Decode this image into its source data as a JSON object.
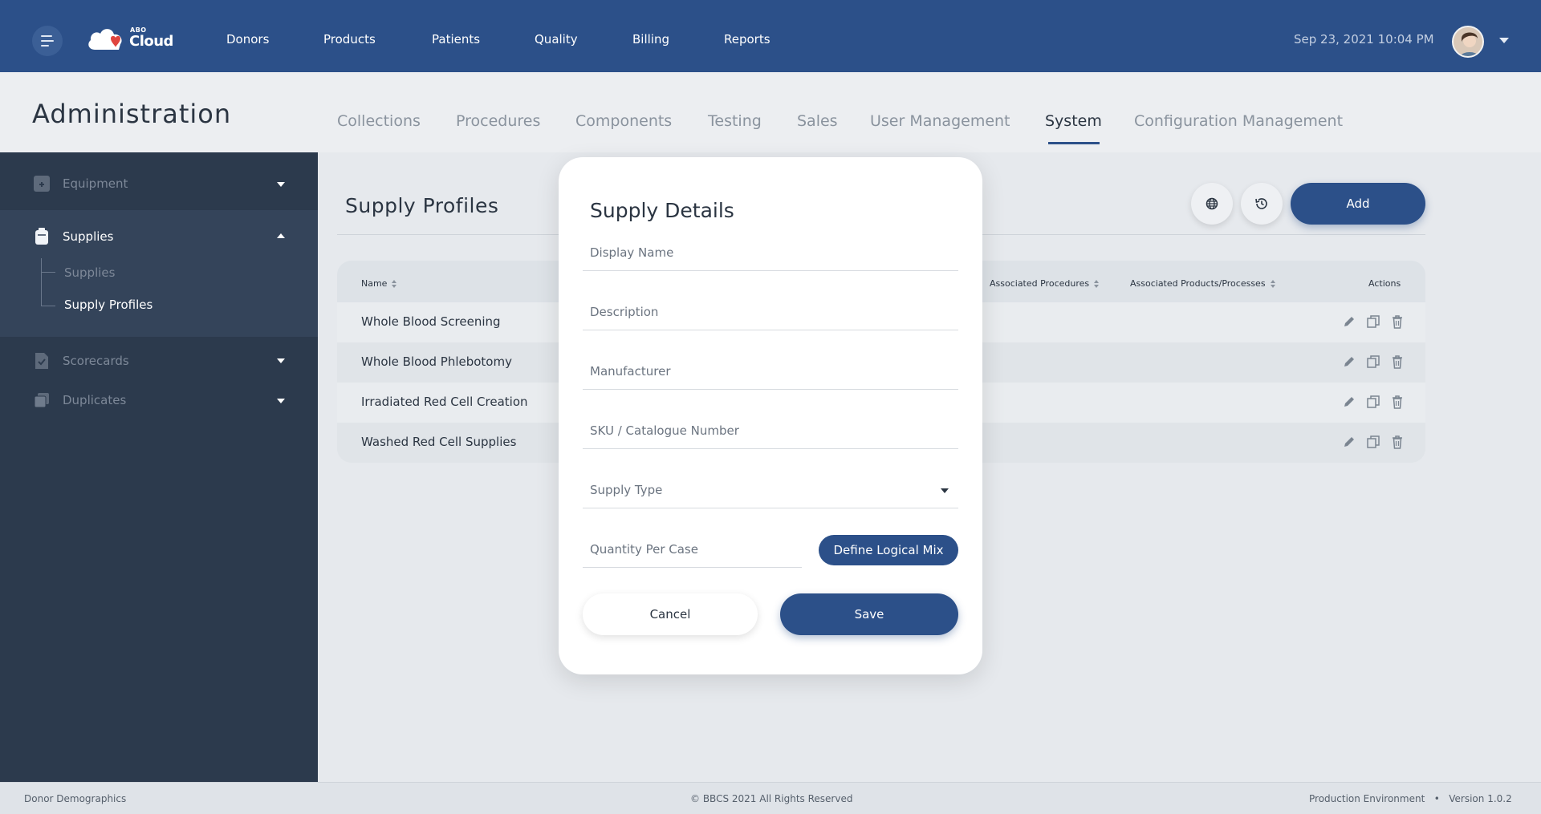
{
  "header": {
    "logo_small": "ABO",
    "logo_main": "Cloud",
    "nav": [
      "Donors",
      "Products",
      "Patients",
      "Quality",
      "Billing",
      "Reports"
    ],
    "datetime": "Sep 23, 2021 10:04 PM"
  },
  "admin": {
    "title": "Administration",
    "tabs": [
      "Collections",
      "Procedures",
      "Components",
      "Testing",
      "Sales",
      "User Management",
      "System",
      "Configuration Management"
    ],
    "active_tab": "System"
  },
  "sidebar": {
    "equipment": "Equipment",
    "supplies": "Supplies",
    "sub_supplies": "Supplies",
    "sub_profiles": "Supply Profiles",
    "scorecards": "Scorecards",
    "duplicates": "Duplicates"
  },
  "main": {
    "title": "Supply Profiles",
    "add_label": "Add",
    "columns": {
      "name": "Name",
      "procedures": "Associated Procedures",
      "products": "Associated Products/Processes",
      "actions": "Actions"
    },
    "rows": [
      "Whole Blood Screening",
      "Whole Blood Phlebotomy",
      "Irradiated Red Cell Creation",
      "Washed Red Cell Supplies"
    ]
  },
  "modal": {
    "title": "Supply Details",
    "display_name": "Display Name",
    "description": "Description",
    "manufacturer": "Manufacturer",
    "sku": "SKU / Catalogue Number",
    "supply_type": "Supply Type",
    "quantity": "Quantity Per Case",
    "logical_mix": "Define Logical Mix",
    "cancel": "Cancel",
    "save": "Save"
  },
  "footer": {
    "left": "Donor Demographics",
    "center": "© BBCS 2021 All Rights Reserved",
    "right": "Production Environment   •   Version 1.0.2"
  },
  "colors": {
    "primary": "#2c5089",
    "sidebar": "#2c3a4d",
    "background": "#e6e9ed"
  },
  "icons": [
    "menu-icon",
    "globe-icon",
    "history-icon",
    "edit-icon",
    "copy-icon",
    "trash-icon",
    "equipment-icon",
    "supplies-icon",
    "scorecards-icon",
    "duplicates-icon"
  ]
}
